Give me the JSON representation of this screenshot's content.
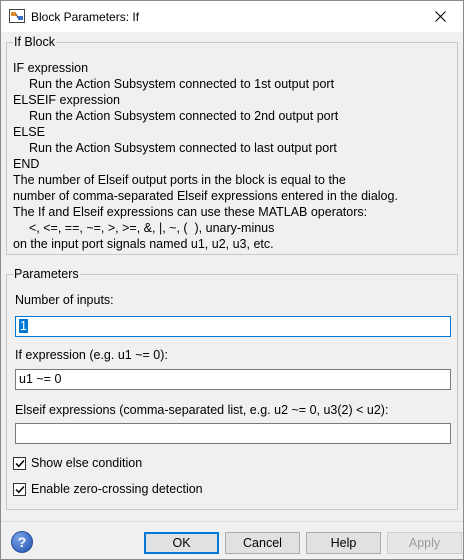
{
  "window": {
    "title": "Block Parameters: If",
    "icons": {
      "app": "simulink-block-icon",
      "close": "close-icon"
    }
  },
  "description": {
    "group_title": "If Block",
    "lines": [
      "IF expression",
      "Run the Action Subsystem connected to 1st output port",
      "ELSEIF expression",
      "Run the Action Subsystem connected to 2nd output port",
      "ELSE",
      "Run the Action Subsystem connected to last output port",
      "END",
      "The number of Elseif output ports in the block is equal to the",
      "number of comma-separated Elseif expressions entered in the dialog.",
      "The If and Elseif expressions can use these MATLAB operators:",
      "<, <=, ==, ~=, >, >=, &, |, ~, (  ), unary-minus",
      "on the input port signals named u1, u2, u3, etc."
    ]
  },
  "parameters": {
    "group_title": "Parameters",
    "num_inputs_label": "Number of inputs:",
    "num_inputs_value": "1",
    "if_expr_label": "If expression (e.g. u1 ~= 0):",
    "if_expr_value": "u1 ~= 0",
    "elseif_label": "Elseif expressions (comma-separated list, e.g. u2 ~= 0, u3(2) < u2):",
    "elseif_value": "",
    "show_else_label": "Show else condition",
    "show_else_checked": true,
    "zero_crossing_label": "Enable zero-crossing detection",
    "zero_crossing_checked": true
  },
  "footer": {
    "help_icon": "help-icon",
    "ok_label": "OK",
    "cancel_label": "Cancel",
    "help_label": "Help",
    "apply_label": "Apply"
  },
  "colors": {
    "accent": "#0078d7",
    "background": "#f0f0f0"
  }
}
